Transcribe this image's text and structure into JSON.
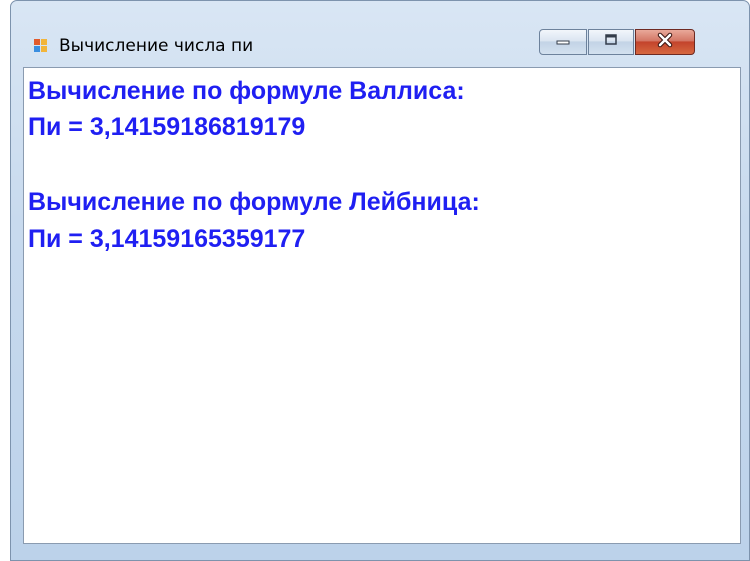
{
  "window": {
    "title": "Вычисление числа пи",
    "icon": "windows-form-icon"
  },
  "controls": {
    "minimize_icon": "minimize-icon",
    "maximize_icon": "maximize-icon",
    "close_icon": "close-icon"
  },
  "results": {
    "wallis_heading": "Вычисление по формуле Валлиса:",
    "wallis_value": "Пи = 3,14159186819179",
    "leibniz_heading": "Вычисление по формуле Лейбница:",
    "leibniz_value": "Пи = 3,14159165359177"
  },
  "colors": {
    "text_accent": "#1f1ff2",
    "close_button": "#c3442c",
    "frame": "#c8daee"
  }
}
